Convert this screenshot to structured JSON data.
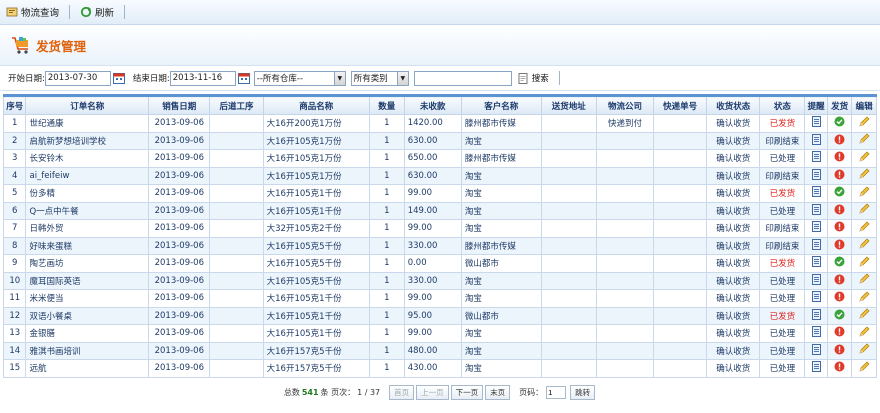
{
  "toolbar": {
    "query_label": "物流查询",
    "refresh_label": "刷新"
  },
  "panel": {
    "title": "发货管理"
  },
  "filter": {
    "start_label": "开始日期:",
    "start_value": "2013-07-30",
    "end_label": "结束日期:",
    "end_value": "2013-11-16",
    "warehouse_value": "--所有仓库--",
    "category_value": "所有类别",
    "keyword_value": "",
    "search_label": "搜索"
  },
  "table": {
    "headers": [
      "序号",
      "订单名称",
      "销售日期",
      "后道工序",
      "商品名称",
      "数量",
      "未收款",
      "客户名称",
      "送货地址",
      "物流公司",
      "快递单号",
      "收货状态",
      "状态",
      "提醒",
      "发货",
      "编辑"
    ],
    "rows": [
      {
        "no": "1",
        "order": "世纪通康",
        "date": "2013-09-06",
        "post": "",
        "product": "大16开200克1万份",
        "qty": "1",
        "unpaid": "1420.00",
        "customer": "滕州都市传媒",
        "address": "",
        "logistics": "快递到付",
        "tracking": "",
        "recv": "确认收货",
        "status": "已发货",
        "status_color": "#e0201a",
        "ship": "ok"
      },
      {
        "no": "2",
        "order": "启航新梦想培训学校",
        "date": "2013-09-06",
        "post": "",
        "product": "大16开105克1万份",
        "qty": "1",
        "unpaid": "630.00",
        "customer": "淘宝",
        "address": "",
        "logistics": "",
        "tracking": "",
        "recv": "确认收货",
        "status": "印刷结束",
        "status_color": "#1f3b66",
        "ship": "warn"
      },
      {
        "no": "3",
        "order": "长安铃木",
        "date": "2013-09-06",
        "post": "",
        "product": "大16开105克1万份",
        "qty": "1",
        "unpaid": "650.00",
        "customer": "滕州都市传媒",
        "address": "",
        "logistics": "",
        "tracking": "",
        "recv": "确认收货",
        "status": "已处理",
        "status_color": "#1f3b66",
        "ship": "warn"
      },
      {
        "no": "4",
        "order": "ai_feifeiw",
        "date": "2013-09-06",
        "post": "",
        "product": "大16开105克1万份",
        "qty": "1",
        "unpaid": "630.00",
        "customer": "淘宝",
        "address": "",
        "logistics": "",
        "tracking": "",
        "recv": "确认收货",
        "status": "印刷结束",
        "status_color": "#1f3b66",
        "ship": "warn"
      },
      {
        "no": "5",
        "order": "份多精",
        "date": "2013-09-06",
        "post": "",
        "product": "大16开105克1千份",
        "qty": "1",
        "unpaid": "99.00",
        "customer": "淘宝",
        "address": "",
        "logistics": "",
        "tracking": "",
        "recv": "确认收货",
        "status": "已发货",
        "status_color": "#e0201a",
        "ship": "ok"
      },
      {
        "no": "6",
        "order": "Q一点中午餐",
        "date": "2013-09-06",
        "post": "",
        "product": "大16开105克1千份",
        "qty": "1",
        "unpaid": "149.00",
        "customer": "淘宝",
        "address": "",
        "logistics": "",
        "tracking": "",
        "recv": "确认收货",
        "status": "已处理",
        "status_color": "#1f3b66",
        "ship": "warn"
      },
      {
        "no": "7",
        "order": "日韩外贸",
        "date": "2013-09-06",
        "post": "",
        "product": "大32开105克2千份",
        "qty": "1",
        "unpaid": "99.00",
        "customer": "淘宝",
        "address": "",
        "logistics": "",
        "tracking": "",
        "recv": "确认收货",
        "status": "印刷结束",
        "status_color": "#1f3b66",
        "ship": "warn"
      },
      {
        "no": "8",
        "order": "好味来蛋糕",
        "date": "2013-09-06",
        "post": "",
        "product": "大16开105克5千份",
        "qty": "1",
        "unpaid": "330.00",
        "customer": "滕州都市传媒",
        "address": "",
        "logistics": "",
        "tracking": "",
        "recv": "确认收货",
        "status": "印刷结束",
        "status_color": "#1f3b66",
        "ship": "warn"
      },
      {
        "no": "9",
        "order": "陶艺画坊",
        "date": "2013-09-06",
        "post": "",
        "product": "大16开105克5千份",
        "qty": "1",
        "unpaid": "0.00",
        "customer": "微山都市",
        "address": "",
        "logistics": "",
        "tracking": "",
        "recv": "确认收货",
        "status": "已发货",
        "status_color": "#e0201a",
        "ship": "ok"
      },
      {
        "no": "10",
        "order": "魔耳国际英语",
        "date": "2013-09-06",
        "post": "",
        "product": "大16开105克5千份",
        "qty": "1",
        "unpaid": "330.00",
        "customer": "淘宝",
        "address": "",
        "logistics": "",
        "tracking": "",
        "recv": "确认收货",
        "status": "已处理",
        "status_color": "#1f3b66",
        "ship": "warn"
      },
      {
        "no": "11",
        "order": "米米便当",
        "date": "2013-09-06",
        "post": "",
        "product": "大16开105克1千份",
        "qty": "1",
        "unpaid": "99.00",
        "customer": "淘宝",
        "address": "",
        "logistics": "",
        "tracking": "",
        "recv": "确认收货",
        "status": "已处理",
        "status_color": "#1f3b66",
        "ship": "warn"
      },
      {
        "no": "12",
        "order": "双语小餐桌",
        "date": "2013-09-06",
        "post": "",
        "product": "大16开105克1千份",
        "qty": "1",
        "unpaid": "95.00",
        "customer": "微山都市",
        "address": "",
        "logistics": "",
        "tracking": "",
        "recv": "确认收货",
        "status": "已发货",
        "status_color": "#e0201a",
        "ship": "ok"
      },
      {
        "no": "13",
        "order": "金银膳",
        "date": "2013-09-06",
        "post": "",
        "product": "大16开105克1千份",
        "qty": "1",
        "unpaid": "99.00",
        "customer": "淘宝",
        "address": "",
        "logistics": "",
        "tracking": "",
        "recv": "确认收货",
        "status": "已处理",
        "status_color": "#1f3b66",
        "ship": "warn"
      },
      {
        "no": "14",
        "order": "雅淇书画培训",
        "date": "2013-09-06",
        "post": "",
        "product": "大16开157克5千份",
        "qty": "1",
        "unpaid": "480.00",
        "customer": "淘宝",
        "address": "",
        "logistics": "",
        "tracking": "",
        "recv": "确认收货",
        "status": "已处理",
        "status_color": "#1f3b66",
        "ship": "warn"
      },
      {
        "no": "15",
        "order": "远航",
        "date": "2013-09-06",
        "post": "",
        "product": "大16开157克5千份",
        "qty": "1",
        "unpaid": "430.00",
        "customer": "淘宝",
        "address": "",
        "logistics": "",
        "tracking": "",
        "recv": "确认收货",
        "status": "已处理",
        "status_color": "#1f3b66",
        "ship": "warn"
      }
    ]
  },
  "pager": {
    "total_prefix": "总数",
    "total": "541",
    "total_suffix": "条 页次：",
    "page": "1 / 37",
    "first": "首页",
    "prev": "上一页",
    "next": "下一页",
    "last": "末页",
    "goto_label": "页码：",
    "goto_value": "1",
    "jump": "跳转"
  },
  "colors": {
    "accent_orange": "#e0620d",
    "header_blue": "#5b95d1",
    "shipped_red": "#e0201a",
    "ok_green": "#3aa33a",
    "warn_red": "#e03a2a"
  },
  "icons": {
    "reminder": "reminder-doc-icon",
    "ship_ok": "ship-ok-icon",
    "ship_warn": "ship-warn-icon",
    "edit": "edit-pencil-icon"
  }
}
